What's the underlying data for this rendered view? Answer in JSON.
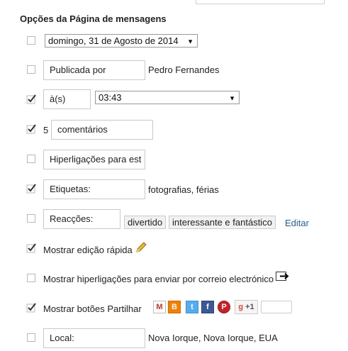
{
  "section_title": "Opções da Página de mensagens",
  "rows": {
    "date": {
      "value": "domingo, 31 de Agosto de 2014",
      "checked": false
    },
    "published_by": {
      "label": "Publicada por",
      "value": "Pedro Fernandes",
      "checked": false
    },
    "time": {
      "label": "à(s)",
      "value": "03:43",
      "checked": true
    },
    "comments": {
      "count": "5",
      "label": "comentários",
      "checked": true
    },
    "links": {
      "label": "Hiperligações para est",
      "checked": false
    },
    "labels": {
      "label": "Etiquetas:",
      "value": "fotografias, férias",
      "checked": true
    },
    "reactions": {
      "label": "Reacções:",
      "tags": [
        "divertido",
        "interessante e fantástico"
      ],
      "edit": "Editar",
      "checked": false
    },
    "quick_edit": {
      "label": "Mostrar edição rápida",
      "checked": true,
      "icon": "pencil-icon"
    },
    "email_links": {
      "label": "Mostrar hiperligações para enviar por correio electrónico",
      "checked": false,
      "icon": "email-post-icon"
    },
    "share": {
      "label": "Mostrar botões Partilhar",
      "checked": true,
      "gplus": "+1",
      "buttons": [
        "gmail-icon",
        "blogger-icon",
        "twitter-icon",
        "facebook-icon",
        "pinterest-icon"
      ]
    },
    "location": {
      "label": "Local:",
      "value": "Nova Iorque, Nova Iorque, EUA",
      "checked": false
    }
  },
  "colors": {
    "blogger": "#f57d00",
    "twitter": "#55acee",
    "facebook": "#3b5998",
    "pinterest": "#cb2027",
    "gplus": "#dd4b39",
    "link": "#2060a8"
  }
}
